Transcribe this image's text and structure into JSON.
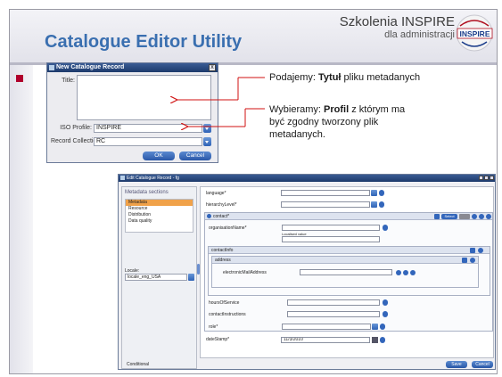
{
  "slide": {
    "title": "Catalogue Editor Utility",
    "brand_main": "Szkolenia INSPIRE",
    "brand_sub": "dla administracji",
    "logo_text": "INSPIRE"
  },
  "dialog_new": {
    "title": "New Catalogue Record",
    "close_symbol": "x",
    "title_label": "Title:",
    "title_value": "",
    "iso_profile_label": "ISO Profile:",
    "iso_profile_value": "INSPIRE",
    "record_collection_label": "Record Collection:",
    "record_collection_value": "RC",
    "ok_label": "OK",
    "cancel_label": "Cancel"
  },
  "annotations": {
    "note1_pre": "Podajemy: ",
    "note1_bold": "Tytuł",
    "note1_post": " pliku metadanych",
    "note2_pre": "Wybieramy: ",
    "note2_bold": "Profil",
    "note2_line1_post": " z którym ma",
    "note2_line2": "być zgodny tworzony plik",
    "note2_line3": "metadanych."
  },
  "dialog_edit": {
    "title": "Edit Catalogue Record - fg",
    "sidebar": {
      "header": "Metadata sections",
      "items": [
        "Metadata",
        "Resource",
        "Distribution",
        "Data quality"
      ],
      "selected_index": 0,
      "locale_label": "Locale:",
      "locale_value": "locale_eng_USA",
      "conditional_label": "Conditional"
    },
    "form": {
      "language_label": "language*",
      "hierarchy_label": "hierarchyLevel*",
      "contact_label": "contact*",
      "select_label": "Select",
      "org_label": "organisationName*",
      "localised_label": "Localised value",
      "contactinfo_label": "contactInfo",
      "address_label": "address",
      "email_label": "electronicMailAddress",
      "hours_label": "hoursOfService",
      "instructions_label": "contactInstructions",
      "role_label": "role*",
      "datestamp_label": "dateStamp*",
      "datestamp_value": "11/3/2010"
    },
    "save_label": "Save",
    "cancel_label": "Cancel"
  },
  "colors": {
    "title_blue": "#3a6fb0",
    "bullet_red": "#b0002c",
    "arrow_red": "#d01010",
    "selected_orange": "#f0a24a"
  }
}
